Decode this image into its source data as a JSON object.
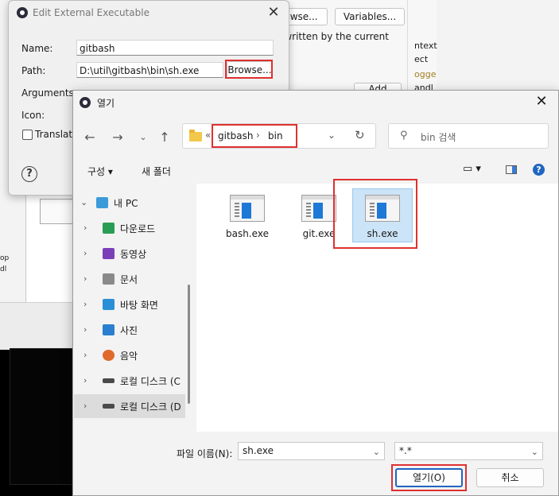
{
  "background": {
    "buttons": {
      "browse_partial": "owse...",
      "variables": "Variables...",
      "add_partial": "Add"
    },
    "text": {
      "overwritten": "erwritten by the current"
    },
    "strip_lines": [
      "ntext",
      "ect",
      "ogge",
      "andl"
    ],
    "left_lines": [
      "op",
      "dl"
    ]
  },
  "edit_dialog": {
    "title": "Edit External Executable",
    "fields": {
      "name_label": "Name:",
      "name_value": "gitbash",
      "path_label": "Path:",
      "path_value": "D:\\util\\gitbash\\bin\\sh.exe",
      "arguments_label": "Arguments:",
      "icon_label": "Icon:"
    },
    "browse_label": "Browse...",
    "translate_label": "Translate",
    "help_glyph": "?"
  },
  "open_dialog": {
    "title": "열기",
    "breadcrumb": [
      "gitbash",
      "bin"
    ],
    "search_placeholder": "bin 검색",
    "toolbar": {
      "organize": "구성 ▾",
      "new_folder": "새 폴더",
      "help": "?"
    },
    "tree": [
      {
        "label": "내 PC",
        "expanded": true,
        "icon": "pc-icon",
        "color": "#3a9bd8"
      },
      {
        "label": "다운로드",
        "icon": "download-icon",
        "color": "#2a9d55"
      },
      {
        "label": "동영상",
        "icon": "video-icon",
        "color": "#7b3fb8"
      },
      {
        "label": "문서",
        "icon": "document-icon",
        "color": "#8a8a8a"
      },
      {
        "label": "바탕 화면",
        "icon": "desktop-icon",
        "color": "#2a8fd6"
      },
      {
        "label": "사진",
        "icon": "picture-icon",
        "color": "#2a7fd0"
      },
      {
        "label": "음악",
        "icon": "music-icon",
        "color": "#e06a2c"
      },
      {
        "label": "로컬 디스크 (C",
        "icon": "drive-icon",
        "color": "#4a4a4a"
      },
      {
        "label": "로컬 디스크 (D",
        "icon": "drive-icon",
        "color": "#4a4a4a",
        "selected": true
      }
    ],
    "files": [
      {
        "name": "bash.exe"
      },
      {
        "name": "git.exe"
      },
      {
        "name": "sh.exe",
        "selected": true
      }
    ],
    "filename_label": "파일 이름(N):",
    "filename_value": "sh.exe",
    "filetype_value": "*.*",
    "open_button": "열기(O)",
    "cancel_button": "취소"
  },
  "colors": {
    "highlight_red": "#e03030",
    "selection_blue": "#cce4f7",
    "accent_blue": "#1f66c1"
  }
}
